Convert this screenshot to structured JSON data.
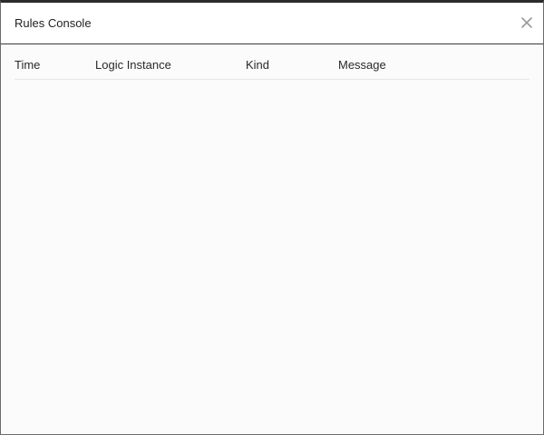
{
  "window": {
    "title": "Rules Console",
    "close_icon": "close-icon"
  },
  "table": {
    "columns": [
      "Time",
      "Logic Instance",
      "Kind",
      "Message"
    ],
    "rows": []
  },
  "colors": {
    "background": "#fcfbfb",
    "title_bar": "#ffffff",
    "divider": "#3a3a3a",
    "close_icon": "#9a9a9a"
  }
}
